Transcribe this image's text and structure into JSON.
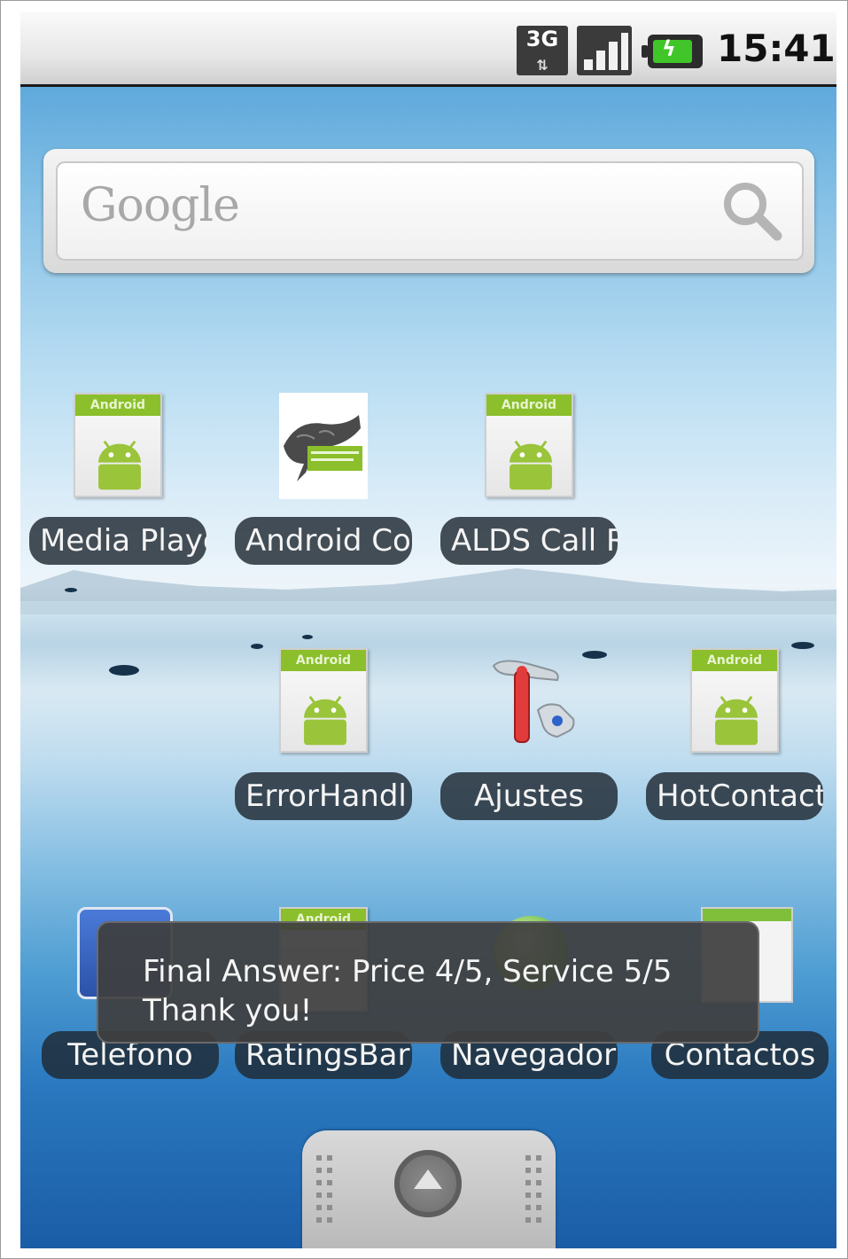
{
  "status_bar": {
    "network": "3G",
    "time": "15:41"
  },
  "search_widget": {
    "logo_text": "Google",
    "icon": "search-icon"
  },
  "apps_row1": [
    {
      "label": "Media Playe",
      "icon": "android-app-icon"
    },
    {
      "label": "Android Co",
      "icon": "android-cookbook-icon"
    },
    {
      "label": "ALDS Call R",
      "icon": "android-app-icon"
    }
  ],
  "apps_row2": [
    {
      "label": "ErrorHandl",
      "icon": "android-app-icon"
    },
    {
      "label": "Ajustes",
      "icon": "settings-tools-icon"
    },
    {
      "label": "HotContact",
      "icon": "android-app-icon"
    }
  ],
  "dock": [
    {
      "label": "Telefono",
      "icon": "phone-icon"
    },
    {
      "label": "RatingsBar",
      "icon": "android-app-icon"
    },
    {
      "label": "Navegador",
      "icon": "browser-globe-icon"
    },
    {
      "label": "Contactos",
      "icon": "contacts-icon"
    }
  ],
  "toast": {
    "line1": "Final Answer: Price 4/5, Service 5/5",
    "line2": "Thank you!"
  },
  "drawer": {
    "icon": "arrow-up-icon"
  }
}
